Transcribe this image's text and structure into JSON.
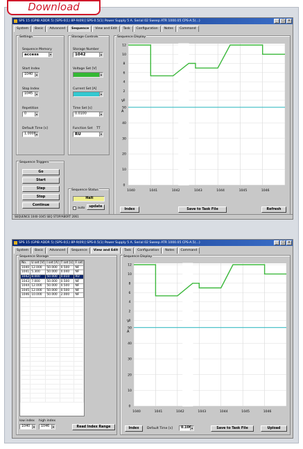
{
  "download_label": "Download",
  "window1": {
    "title": "SPS 15 (GPIB ADDR 5) [SPS-0(1) 8P-9(09)] SPS-0.5(1) Power Supply 5 A. Serial 02 Sweep ATR 1000.05 CPS-A.5(...)",
    "tabs": [
      "System",
      "Basic",
      "Advanced",
      "Sequence",
      "View and Edit",
      "Task",
      "Configuration",
      "Notes",
      "Command"
    ],
    "active_tab": "Sequence",
    "settings": {
      "group_label": "Settings",
      "memory_label": "Sequence Memory",
      "memory_value": "access",
      "start_label": "Start Index",
      "start_value": "1040",
      "stop_label": "Stop Index",
      "stop_value": "1045",
      "repetition_label": "Repetition",
      "repetition_value": "0",
      "default_time_label": "Default Time [s]",
      "default_time_value": "1.0000"
    },
    "triggers": {
      "group_label": "Sequence Triggers",
      "buttons": [
        "Go",
        "Start",
        "Step",
        "Stop",
        "Continue"
      ]
    },
    "storage": {
      "group_label": "Storage Controls",
      "number_label": "Storage Number",
      "number_value": "1042",
      "voltage_label": "Voltage Set [V]",
      "voltage_value": "",
      "current_label": "Current Set [A]",
      "current_value": "",
      "time_label": "Time Set [s]",
      "time_value": "0.0100",
      "function_label": "Function Set",
      "function_extra": "TT",
      "function_value": "RU"
    },
    "status_group": {
      "group_label": "Sequence Status",
      "value": "Halt",
      "auto_label": "auto",
      "update_label": "update"
    },
    "display": {
      "group_label": "Sequence Display",
      "index_button": "Index",
      "save_button": "Save to Task File",
      "refresh_button": "Refresh",
      "volt_axis_label": "V",
      "amp_axis_label": "A"
    },
    "statusbar": "SEQUENCE 1040-1045 SEQ STOP/ABORT 2061"
  },
  "window2": {
    "title": "SPS 15 (GPIB ADDR 5) [SPS-0(1) 8P-9(09)] SPS-0.5(1) Power Supply 5 A. Serial 02 Sweep ATR 1000.05 CPS-A.5(...)",
    "tabs": [
      "System",
      "Basic",
      "Advanced",
      "Sequence",
      "View and Edit",
      "Task",
      "Configuration",
      "Notes",
      "Command"
    ],
    "active_tab": "View and Edit",
    "storage_table": {
      "group_label": "Sequence Storage",
      "headers": [
        "No.",
        "U set [V]",
        "I set [A]",
        "T set [s]",
        "F set"
      ],
      "rows": [
        [
          "1040",
          "12.000",
          "50.000",
          "0.500",
          "NF"
        ],
        [
          "1041",
          "5.300",
          "50.000",
          "0.040",
          "NF"
        ],
        [
          "1042",
          "8.000",
          "50.000",
          "0.010",
          "RU"
        ],
        [
          "1043",
          "7.000",
          "50.000",
          "0.500",
          "NF"
        ],
        [
          "1044",
          "12.000",
          "50.000",
          "0.500",
          "NF"
        ],
        [
          "1045",
          "12.000",
          "50.000",
          "0.500",
          "NF"
        ],
        [
          "1046",
          "10.000",
          "50.000",
          "2.000",
          "NF"
        ]
      ],
      "selected_row": 2
    },
    "low_index_label": "low index",
    "low_index_value": "1040",
    "high_index_label": "high index",
    "high_index_value": "1046",
    "read_button": "Read Index Range",
    "display": {
      "group_label": "Sequence Display",
      "index_button": "Index",
      "default_time_label": "Default Time [s]",
      "default_time_value": "0.100",
      "save_button": "Save to Task File",
      "upload_button": "Upload",
      "volt_axis_label": "V",
      "amp_axis_label": "A"
    }
  },
  "chart_data": [
    {
      "type": "line",
      "x_ticks": [
        "1040",
        "1041",
        "1042",
        "1043",
        "1044",
        "1045",
        "1046"
      ],
      "y_volt_ticks": [
        "12",
        "10",
        "8",
        "6",
        "4",
        "2",
        "0"
      ],
      "y_amp_ticks": [
        "50",
        "40",
        "30",
        "20",
        "10",
        "0"
      ],
      "series": [
        {
          "values": [
            12.0,
            5.3,
            8.0,
            7.0,
            12.0,
            12.0,
            10.0
          ]
        }
      ],
      "current": [
        50,
        50,
        50,
        50,
        50,
        50,
        50
      ]
    },
    {
      "type": "line",
      "x_ticks": [
        "1040",
        "1041",
        "1042",
        "1043",
        "1044",
        "1045",
        "1046"
      ],
      "y_volt_ticks": [
        "12",
        "10",
        "8",
        "6",
        "4",
        "2",
        "0"
      ],
      "y_amp_ticks": [
        "50",
        "40",
        "30",
        "20",
        "10",
        "0"
      ],
      "series": [
        {
          "values": [
            12.0,
            5.3,
            8.0,
            7.0,
            12.0,
            12.0,
            10.0
          ]
        }
      ],
      "current": [
        50,
        50,
        50,
        50,
        50,
        50,
        50
      ]
    }
  ],
  "colors": {
    "trace_voltage": "#3cb83c",
    "trace_current": "#3bbcc4",
    "voltage_field": "#34b834",
    "current_field": "#33c8d0",
    "status_field": "#f0f08c"
  }
}
